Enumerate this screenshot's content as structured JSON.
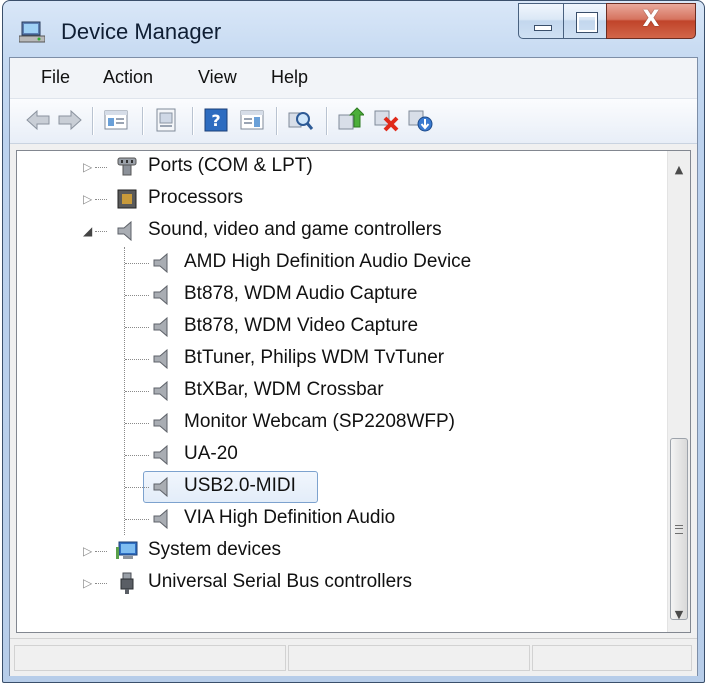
{
  "window": {
    "title": "Device Manager",
    "close_glyph": "X"
  },
  "menu": [
    "File",
    "Action",
    "View",
    "Help"
  ],
  "toolbar": {
    "buttons": [
      "back-icon",
      "forward-icon",
      "show-hide-console-tree-icon",
      "properties-icon",
      "help-icon",
      "action-pane-icon",
      "scan-hardware-icon",
      "update-driver-icon",
      "uninstall-icon",
      "disable-icon"
    ]
  },
  "tree": {
    "categories": {
      "ports": "Ports (COM & LPT)",
      "processors": "Processors",
      "sound": "Sound, video and game controllers",
      "system": "System devices",
      "usb": "Universal Serial Bus controllers"
    },
    "sound_children": [
      "AMD High Definition Audio Device",
      "Bt878, WDM Audio Capture",
      "Bt878, WDM Video Capture",
      "BtTuner, Philips WDM TvTuner",
      "BtXBar, WDM Crossbar",
      "Monitor Webcam (SP2208WFP)",
      "UA-20",
      "USB2.0-MIDI",
      "VIA High Definition Audio"
    ],
    "selected_item": "USB2.0-MIDI"
  },
  "colors": {
    "selection_border": "#7da2ce",
    "close_button": "#c0442a"
  }
}
